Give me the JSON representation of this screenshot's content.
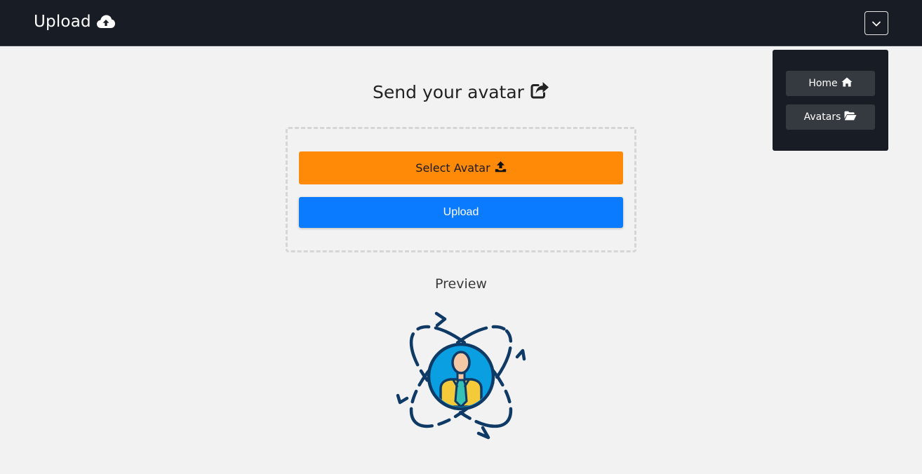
{
  "navbar": {
    "brand": "Upload",
    "brand_icon": "cloud-upload-icon",
    "toggler_icon": "chevron-down-icon"
  },
  "menu": {
    "items": [
      {
        "label": "Home",
        "icon": "home-icon"
      },
      {
        "label": "Avatars",
        "icon": "folder-open-icon"
      }
    ]
  },
  "main": {
    "title": "Send your avatar",
    "title_icon": "share-square-icon",
    "select_button": "Select Avatar",
    "select_icon": "upload-icon",
    "upload_button": "Upload",
    "preview_label": "Preview",
    "preview_image": "avatar-person-icon"
  },
  "colors": {
    "navbar_bg": "#181c24",
    "select_button": "#ff8a08",
    "upload_button": "#0a7bff",
    "page_bg": "#f2f2f2"
  }
}
